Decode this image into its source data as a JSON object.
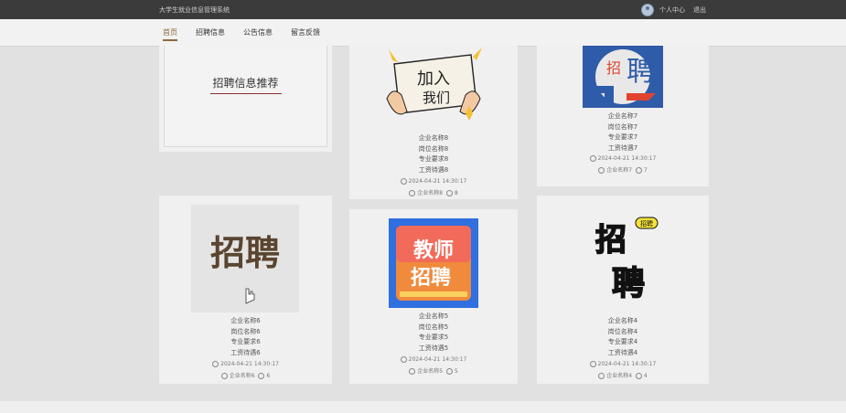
{
  "header": {
    "site_title": "大学生就业信息管理系统",
    "user_center": "个人中心",
    "logout": "退出"
  },
  "nav": [
    "首页",
    "招聘信息",
    "公告信息",
    "留言反馈"
  ],
  "recommend_title": "招聘信息推荐",
  "jobs": [
    {
      "id": "8",
      "company": "企业名称8",
      "position": "岗位名称8",
      "major": "专业要求8",
      "salary": "工资待遇8",
      "time": "2024-04-21 14:30:17",
      "user": "企业名称8",
      "likes": "8",
      "poster_text": [
        "加入",
        "我们"
      ]
    },
    {
      "id": "7",
      "company": "企业名称7",
      "position": "岗位名称7",
      "major": "专业要求7",
      "salary": "工资待遇7",
      "time": "2024-04-21 14:30:17",
      "user": "企业名称7",
      "likes": "7",
      "poster_text": [
        "招",
        "聘"
      ]
    },
    {
      "id": "6",
      "company": "企业名称6",
      "position": "岗位名称6",
      "major": "专业要求6",
      "salary": "工资待遇6",
      "time": "2024-04-21 14:30:17",
      "user": "企业名称6",
      "likes": "6",
      "poster_text": [
        "招聘"
      ]
    },
    {
      "id": "5",
      "company": "企业名称5",
      "position": "岗位名称5",
      "major": "专业要求5",
      "salary": "工资待遇5",
      "time": "2024-04-21 14:30:17",
      "user": "企业名称5",
      "likes": "5",
      "poster_text": [
        "教师",
        "招聘"
      ]
    },
    {
      "id": "4",
      "company": "企业名称4",
      "position": "岗位名称4",
      "major": "专业要求4",
      "salary": "工资待遇4",
      "time": "2024-04-21 14:30:17",
      "user": "企业名称4",
      "likes": "4",
      "poster_text": [
        "招",
        "聘",
        "招聘"
      ]
    }
  ],
  "colors": {
    "accent": "#8b6a3e",
    "topbar": "#3b3b3b",
    "background": "#e1e1e1"
  }
}
